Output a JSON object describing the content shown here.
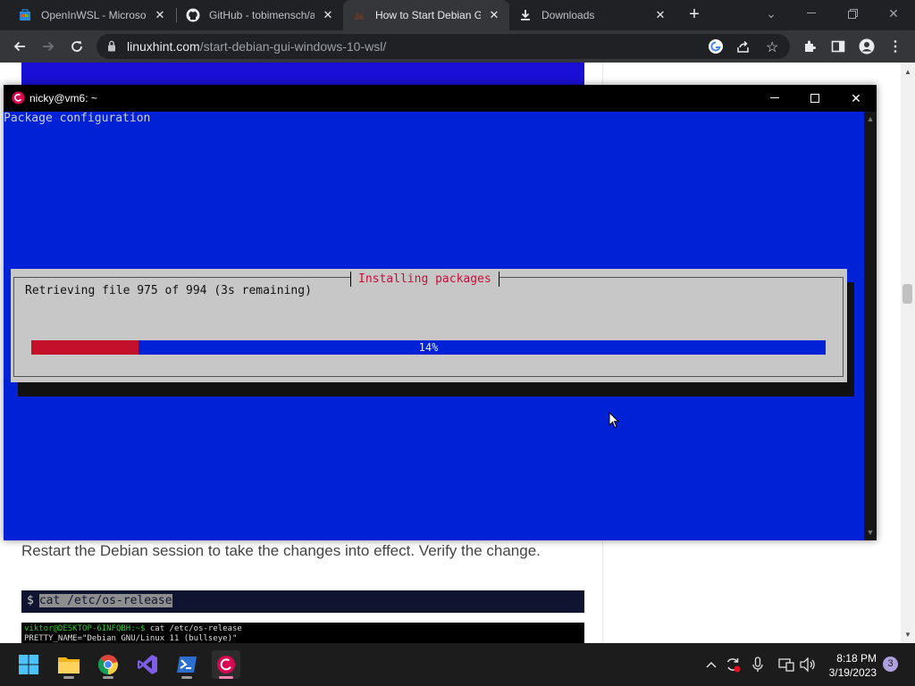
{
  "browser": {
    "tabs": [
      {
        "title": "OpenInWSL - Microsof",
        "icon": "store-icon"
      },
      {
        "title": "GitHub - tobimensch/a",
        "icon": "github-icon"
      },
      {
        "title": "How to Start Debian G",
        "icon": "linuxhint-icon"
      },
      {
        "title": "Downloads",
        "icon": "download-icon"
      }
    ],
    "url_host": "linuxhint.com",
    "url_path": "/start-debian-gui-windows-10-wsl/"
  },
  "page": {
    "text": "Restart the Debian session to take the changes into effect. Verify the change.",
    "cmd_prompt": "$",
    "cmd": "cat /etc/os-release",
    "shot_line1_prompt": "viktor@DESKTOP-6INFQBH:~$",
    "shot_line1_cmd": " cat /etc/os-release",
    "shot_line2": "PRETTY_NAME=\"Debian GNU/Linux 11 (bullseye)\""
  },
  "terminal": {
    "title": "nicky@vm6: ~",
    "header": "Package configuration",
    "dialog_title": "Installing packages",
    "dialog_message": "Retrieving file 975 of 994 (3s remaining)",
    "progress_label": "14%",
    "progress_fraction": 0.135
  },
  "taskbar": {
    "apps": [
      "windows-start-icon",
      "file-explorer-icon",
      "chrome-icon",
      "visual-studio-icon",
      "powershell-icon",
      "debian-icon"
    ],
    "time": "8:18 PM",
    "date": "3/19/2023",
    "notifications": "3"
  },
  "colors": {
    "terminal_bg": "#0022d6",
    "dialog_bg": "#c7c7c7",
    "progress_fill": "#c4102a",
    "dialog_title": "#c4103a"
  }
}
